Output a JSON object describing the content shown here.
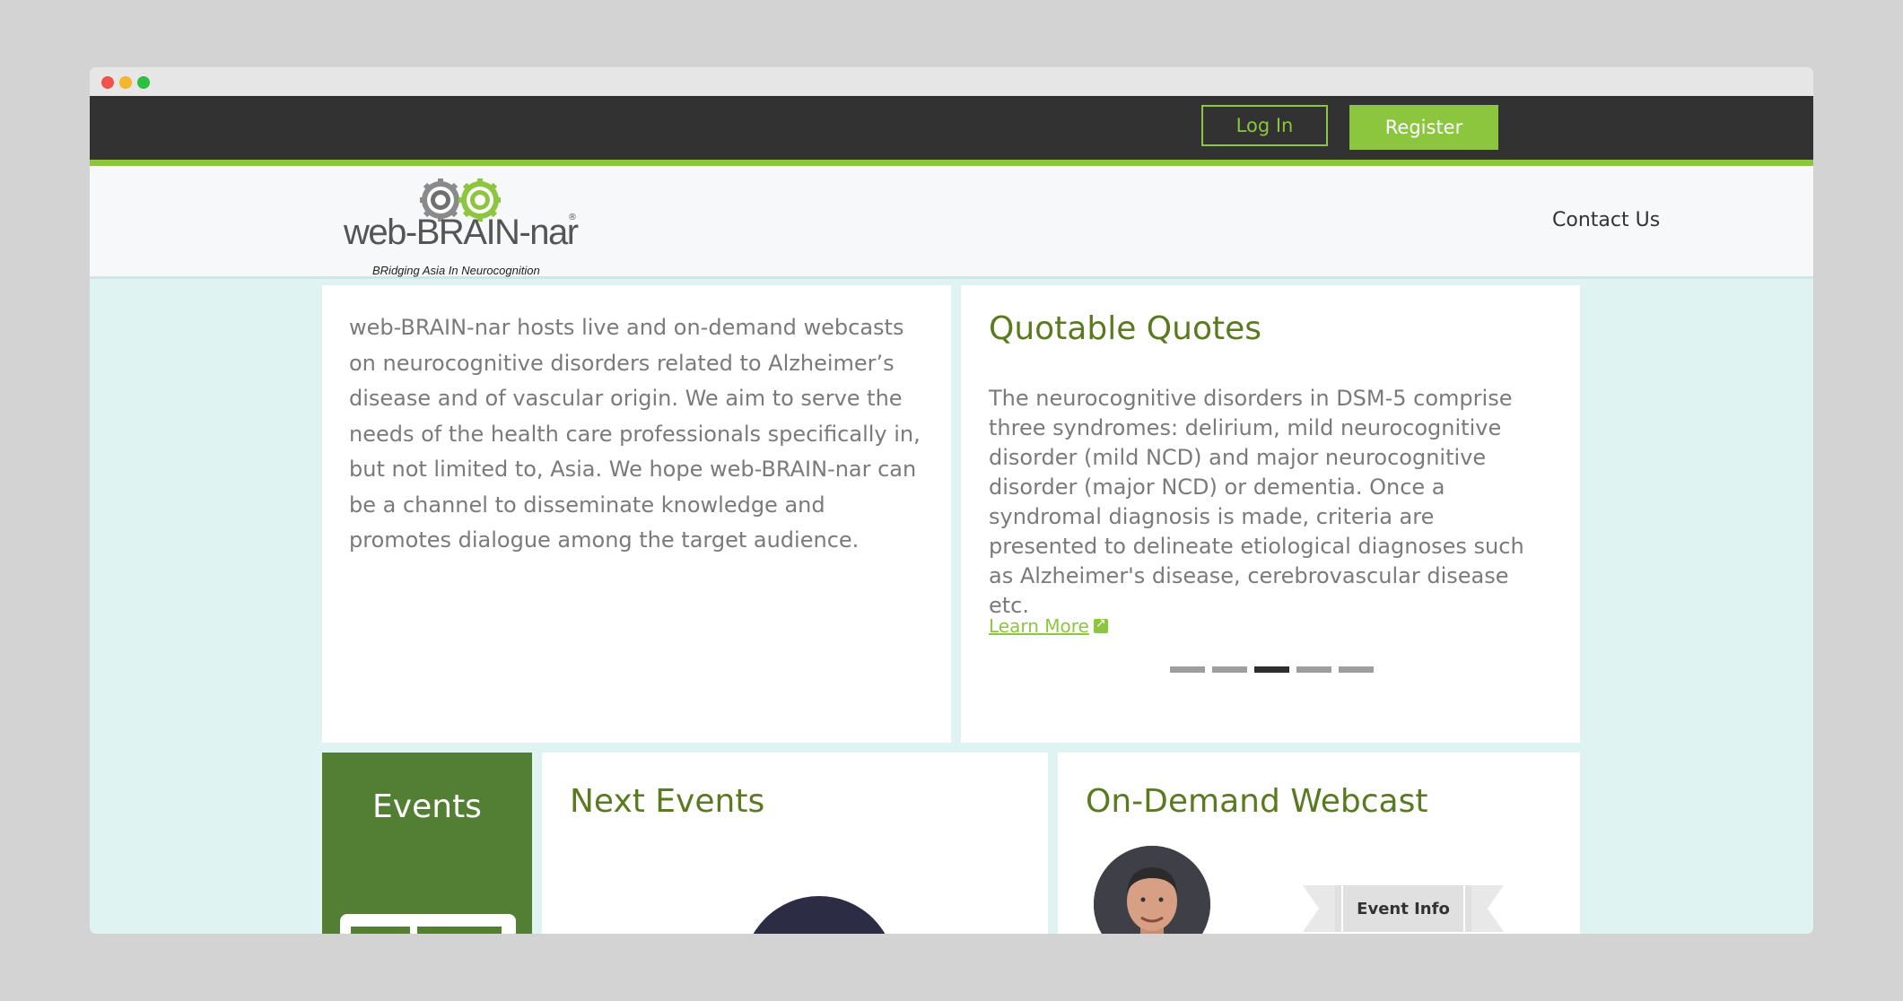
{
  "topbar": {
    "login_label": "Log In",
    "register_label": "Register"
  },
  "logo": {
    "name": "web-BRAIN-nar",
    "registered": "®",
    "tagline": "BRidging Asia In Neurocognition"
  },
  "nav": {
    "contact_label": "Contact Us"
  },
  "intro": {
    "text": "web-BRAIN-nar hosts live and on-demand webcasts on neurocognitive disorders related to Alzheimer’s disease and of vascular origin. We aim to serve the needs of the health care professionals specifically in, but not limited to, Asia. We hope web-BRAIN-nar can be a channel to disseminate knowledge and promotes dialogue among the target audience."
  },
  "quotes": {
    "title": "Quotable Quotes",
    "text": "The neurocognitive disorders in DSM-5 comprise three syndromes: delirium, mild neurocognitive disorder (mild NCD) and major neurocognitive disorder (major NCD) or dementia. Once a syndromal diagnosis is made, criteria are presented to delineate etiological diagnoses such as Alzheimer's disease, cerebrovascular disease etc.",
    "learn_more": "Learn More",
    "slides_total": 5,
    "active_slide": 3
  },
  "events": {
    "title": "Events"
  },
  "next_events": {
    "title": "Next Events"
  },
  "ondemand": {
    "title": "On-Demand Webcast",
    "event_info_label": "Event Info"
  },
  "colors": {
    "accent": "#8cc63f",
    "dark_green": "#537f35",
    "heading_green": "#5a7a1f",
    "topbar": "#323232",
    "page_bg": "#dff3f2"
  },
  "icons": {
    "learn_more": "external-link-icon"
  }
}
